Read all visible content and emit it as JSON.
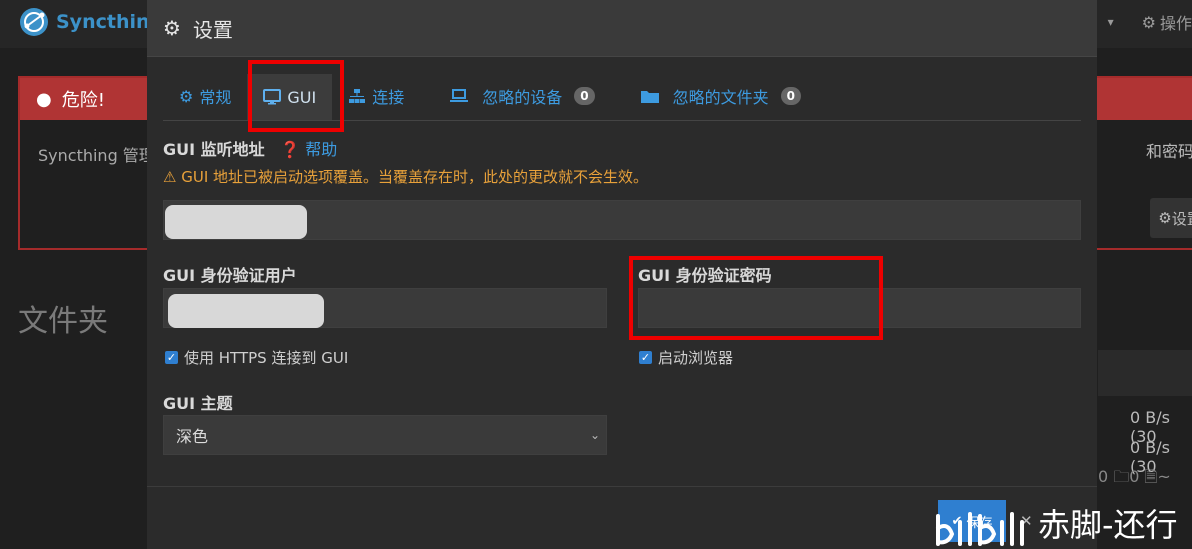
{
  "app": {
    "name": "Syncthing"
  },
  "topbar": {
    "actions_label": "操作"
  },
  "danger": {
    "title": "危险!",
    "body_left": "Syncthing 管理",
    "body_right": "和密码。",
    "settings_button": "设置"
  },
  "folders": {
    "title": "文件夹"
  },
  "right_stats": {
    "rate1": "0 B/s (30",
    "rate2": "0 B/s (30",
    "counts": "0 🗀0 🗎~"
  },
  "modal": {
    "title": "设置",
    "tabs": [
      {
        "label": "常规"
      },
      {
        "label": "GUI"
      },
      {
        "label": "连接"
      },
      {
        "label": "忽略的设备",
        "badge": "0"
      },
      {
        "label": "忽略的文件夹",
        "badge": "0"
      }
    ],
    "gui_address": {
      "label": "GUI 监听地址",
      "help": "帮助",
      "warning": "GUI 地址已被启动选项覆盖。当覆盖存在时，此处的更改就不会生效。"
    },
    "auth_user": {
      "label": "GUI 身份验证用户"
    },
    "auth_password": {
      "label": "GUI 身份验证密码"
    },
    "https_checkbox": {
      "label": "使用 HTTPS 连接到 GUI",
      "checked": true
    },
    "browser_checkbox": {
      "label": "启动浏览器",
      "checked": true
    },
    "theme": {
      "label": "GUI 主题",
      "value": "深色"
    },
    "footer": {
      "save_label": "保存"
    }
  },
  "watermark": {
    "text": "赤脚-还行"
  },
  "colors": {
    "accent": "#3d9be0",
    "danger": "#b03434",
    "highlight": "#ee0000"
  }
}
